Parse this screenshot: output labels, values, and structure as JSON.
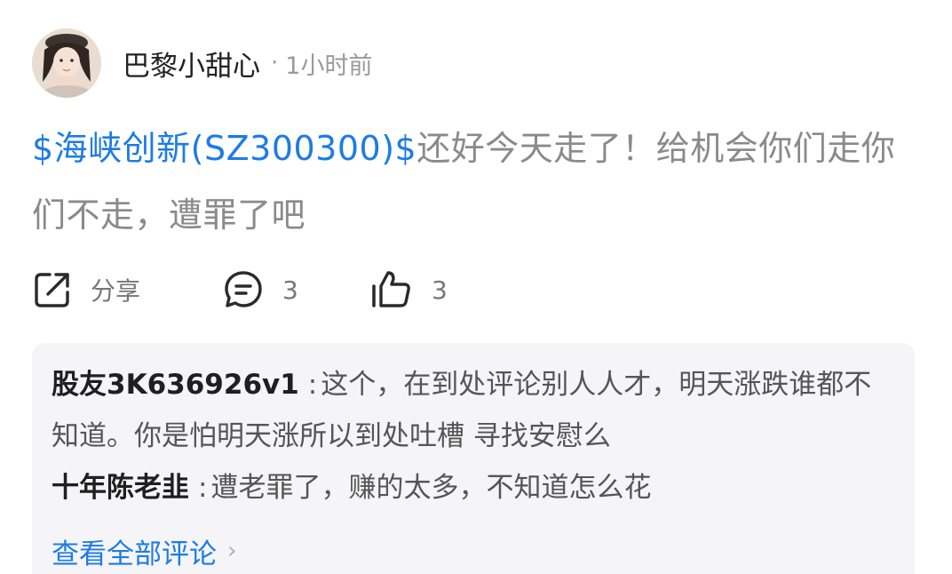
{
  "post": {
    "author": "巴黎小甜心",
    "separator": "·",
    "time": "1小时前",
    "stock_tag": "$海峡创新(SZ300300)$",
    "text": "还好今天走了！给机会你们走你们不走，遭罪了吧"
  },
  "actions": {
    "share_label": "分享",
    "comment_count": "3",
    "like_count": "3"
  },
  "comments": [
    {
      "author": "股友3K636926v1",
      "colon": ":",
      "text": "这个，在到处评论别人人才，明天涨跌谁都不知道。你是怕明天涨所以到处吐槽 寻找安慰么"
    },
    {
      "author": "十年陈老韭",
      "colon": ":",
      "text": "遭老罪了，赚的太多，不知道怎么花"
    }
  ],
  "view_all_label": "查看全部评论",
  "icons": {
    "share": "share-icon",
    "comment": "comment-bubble-icon",
    "like": "thumbs-up-icon",
    "chevron": "chevron-right-icon"
  },
  "colors": {
    "link": "#1e7be6",
    "text_muted": "#8a8a8a",
    "comment_bg": "#f5f5f7"
  }
}
